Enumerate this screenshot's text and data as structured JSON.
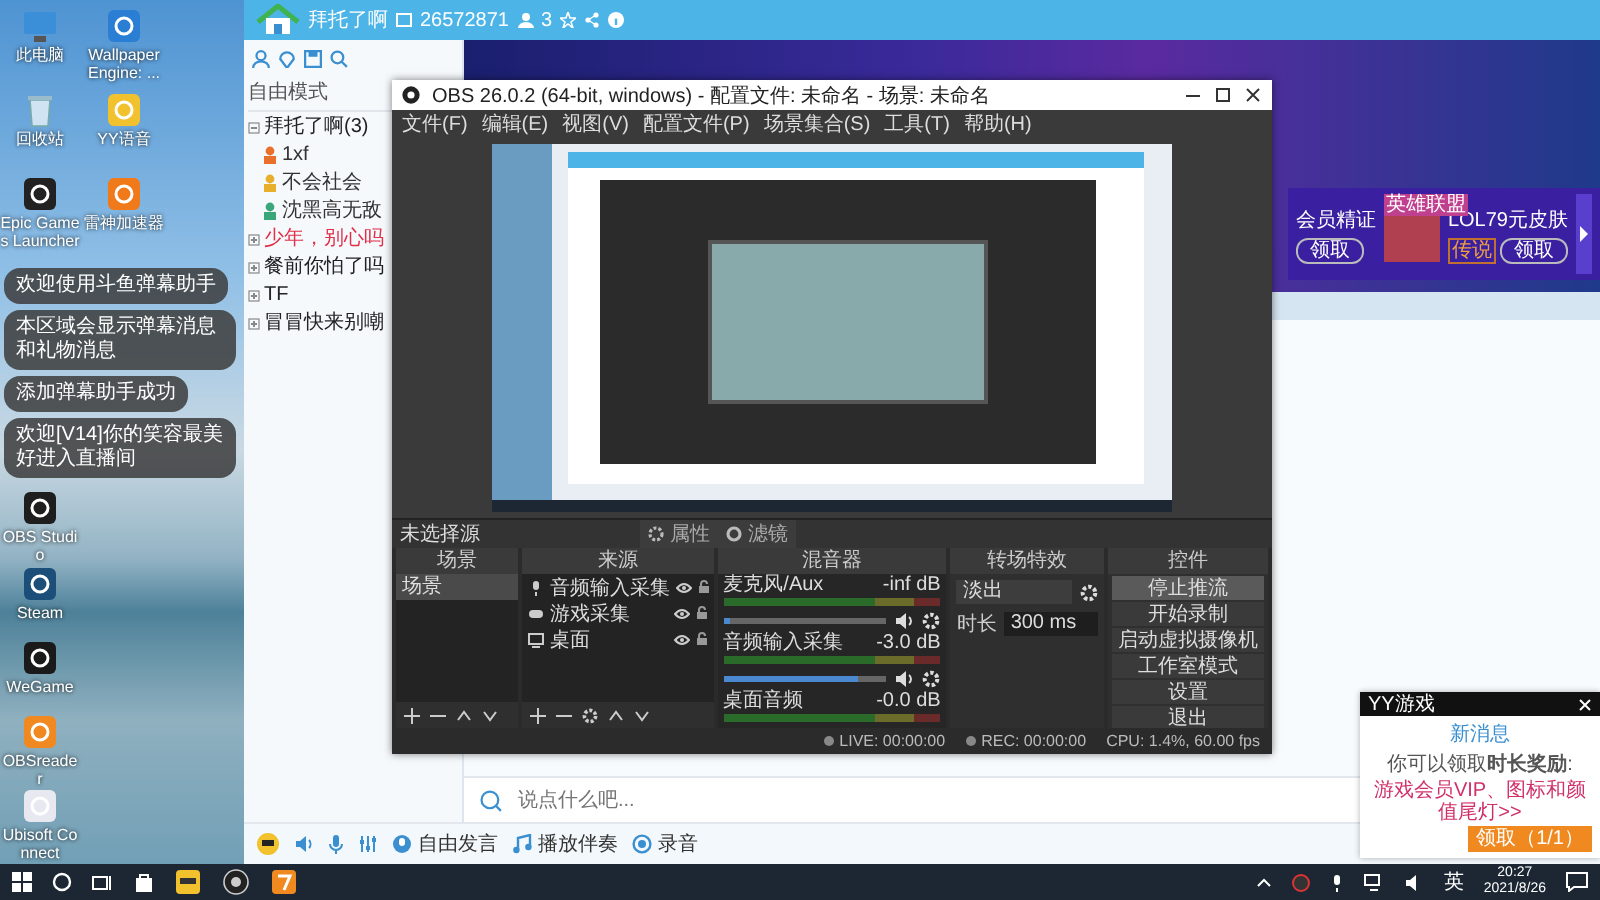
{
  "desktop_icons": [
    {
      "label": "此电脑",
      "kind": "pc"
    },
    {
      "label": "Wallpaper Engine: ...",
      "kind": "wallpaper"
    },
    {
      "label": "回收站",
      "kind": "bin"
    },
    {
      "label": "YY语音",
      "kind": "yy"
    },
    {
      "label": "Epic Games Launcher",
      "kind": "epic"
    },
    {
      "label": "雷神加速器",
      "kind": "leigod"
    },
    {
      "label": "OBS Studio",
      "kind": "obs"
    },
    {
      "label": "Steam",
      "kind": "steam"
    },
    {
      "label": "WeGame",
      "kind": "g"
    },
    {
      "label": "OBSreader",
      "kind": "orange"
    },
    {
      "label": "Ubisoft Connect",
      "kind": "ubisoft"
    }
  ],
  "toasts": [
    "欢迎使用斗鱼弹幕助手",
    "本区域会显示弹幕消息和礼物消息",
    "添加弹幕助手成功",
    "欢迎[V14]你的笑容最美好进入直播间"
  ],
  "chat_app": {
    "channel": {
      "name": "拜托了啊",
      "id": "26572871",
      "users": "3"
    },
    "sidebar": {
      "mode": "自由模式",
      "channels": [
        {
          "name": "拜托了啊(3)",
          "expanded": true,
          "color": "#222222",
          "children": [
            {
              "name": "1xf",
              "color": "#e8702a"
            },
            {
              "name": "不会社会",
              "color": "#e8b02a"
            },
            {
              "name": "沈黑高无敌",
              "color": "#3aa67a"
            }
          ]
        },
        {
          "name": "少年，别心吗",
          "expanded": false,
          "color": "#e0304a"
        },
        {
          "name": "餐前你怕了吗",
          "expanded": false,
          "color": "#222222"
        },
        {
          "name": "TF",
          "expanded": false,
          "color": "#222222"
        },
        {
          "name": "冒冒快来别嘲",
          "expanded": false,
          "color": "#222222"
        }
      ]
    },
    "banner_cards": [
      {
        "title": "会员精证",
        "button": "领取"
      },
      {
        "title": "LOL79元皮肤",
        "tag": "英雄联盟",
        "badge": "传说",
        "button": "领取"
      }
    ],
    "input": {
      "placeholder": "说点什么吧..."
    },
    "toolbar": [
      {
        "label": "自由发言",
        "kind": "talk"
      },
      {
        "label": "播放伴奏",
        "kind": "music"
      },
      {
        "label": "录音",
        "kind": "record"
      }
    ]
  },
  "obs": {
    "title": "OBS 26.0.2 (64-bit, windows) - 配置文件: 未命名 - 场景: 未命名",
    "menu": [
      "文件(F)",
      "编辑(E)",
      "视图(V)",
      "配置文件(P)",
      "场景集合(S)",
      "工具(T)",
      "帮助(H)"
    ],
    "source_bar": {
      "label": "未选择源",
      "buttons": [
        "属性",
        "滤镜"
      ]
    },
    "scenes": {
      "title": "场景",
      "items": [
        {
          "name": "场景",
          "selected": true
        }
      ]
    },
    "sources": {
      "title": "来源",
      "items": [
        {
          "name": "音频输入采集",
          "kind": "mic"
        },
        {
          "name": "游戏采集",
          "kind": "game"
        },
        {
          "name": "桌面",
          "kind": "display"
        }
      ]
    },
    "mixer": {
      "title": "混音器",
      "channels": [
        {
          "name": "麦克风/Aux",
          "reading": "-inf dB",
          "level": 0.04
        },
        {
          "name": "音频输入采集",
          "reading": "-3.0 dB",
          "level": 0.82
        },
        {
          "name": "桌面音频",
          "reading": "-0.0 dB"
        }
      ]
    },
    "transitions": {
      "title": "转场特效",
      "value": "淡出",
      "duration_label": "时长",
      "duration": "300 ms"
    },
    "controls": {
      "title": "控件",
      "buttons": [
        {
          "label": "停止推流",
          "selected": true
        },
        {
          "label": "开始录制",
          "selected": false
        },
        {
          "label": "启动虚拟摄像机",
          "selected": false
        },
        {
          "label": "工作室模式",
          "selected": false
        },
        {
          "label": "设置",
          "selected": false
        },
        {
          "label": "退出",
          "selected": false
        }
      ]
    },
    "status": [
      "LIVE: 00:00:00",
      "REC: 00:00:00",
      "CPU: 1.4%, 60.00 fps"
    ]
  },
  "notification": {
    "app": "YY游戏",
    "title": "新消息",
    "text": "你可以领取**时长奖励**:",
    "link": "游戏会员VIP、图标和颜值尾灯>>",
    "button": "领取（1/1）"
  },
  "taskbar": {
    "ime": "英",
    "time": "20:27",
    "date": "2021/8/26"
  }
}
